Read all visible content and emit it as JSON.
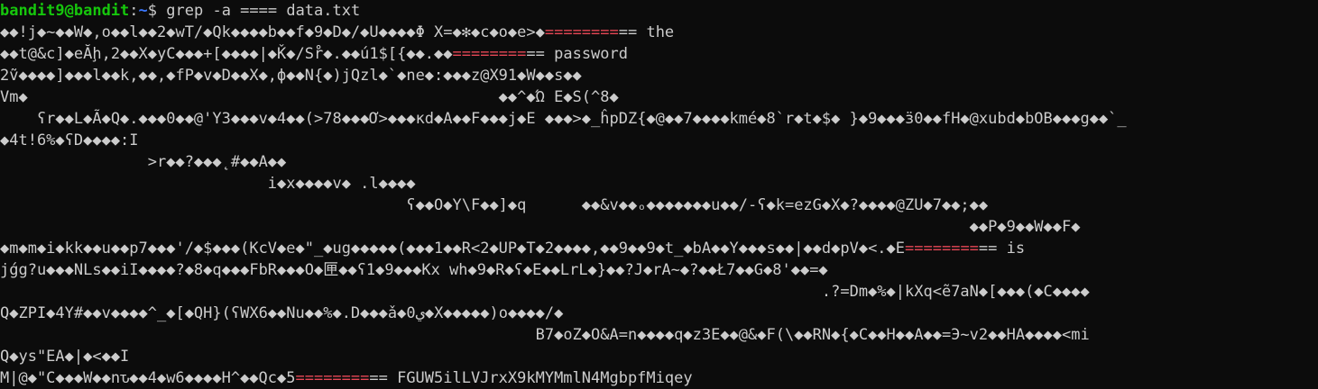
{
  "terminal": {
    "prompt": {
      "userhost": "bandit9@bandit",
      "sep": ":",
      "cwd": "~",
      "symbol": "$ ",
      "command": "grep -a ==== data.txt"
    },
    "lines": [
      {
        "pre": "◆◆!j◆~◆◆W◆,o◆◆l◆◆2◆wT/◆Qk◆◆◆◆b◆◆f◆9◆D◆/◆U◆◆◆◆Φ X=◆✻◆c◆o◆e>◆",
        "hl": "========",
        "post": "== the"
      },
      {
        "pre": "◆◆t@&c]◆eĂḩ,2◆◆X◆yC◆◆◆+[◆◆◆◆|◆Ǩ◆/Sr̊◆.◆◆ú1$[{◆◆.◆◆",
        "hl": "========",
        "post": "== password"
      },
      {
        "pre": "2ṽ◆◆◆◆]◆◆◆l◆◆k,◆◆,◆fP◆v◆D◆◆X◆,ф◆◆N{◆)jQzl◆`◆ne◆:◆◆◆z@X91◆W◆◆s◆◆",
        "hl": "",
        "post": ""
      },
      {
        "pre": "Vm◆                                                   ◆◆^◆Ώ E◆S(^8◆",
        "hl": "",
        "post": ""
      },
      {
        "pre": "    ʕr◆◆L◆Ã◆Q◆.◆◆◆0◆◆@'Y3◆◆◆v◆4◆◆(>78◆◆◆Ơ>◆◆◆κd◆A◆◆F◆◆◆j◆E ◆◆◆>◆_ĥpDZ{◆@◆◆7◆◆◆◆kmé◆8`r◆t◆$◆ }◆9◆◆◆ӟ0◆◆fH◆@xubd◆bOB◆◆◆g◆◆`_",
        "hl": "",
        "post": ""
      },
      {
        "pre": "◆4t!6%◆ʕD◆◆◆◆:I",
        "hl": "",
        "post": ""
      },
      {
        "pre": "                >r◆◆?◆◆◆˛#◆◆A◆◆",
        "hl": "",
        "post": ""
      },
      {
        "pre": "                             i◆x◆◆◆◆v◆ .l◆◆◆◆",
        "hl": "",
        "post": ""
      },
      {
        "pre": "                                            ʕ◆◆O◆Y\\F◆◆]◆q      ◆◆&v◆◆ₒ◆◆◆◆◆◆◆u◆◆/-ʕ◆k=ezG◆X◆?◆◆◆◆@ZU◆7◆◆;◆◆",
        "hl": "",
        "post": ""
      },
      {
        "pre": "                                                                                                         ◆◆P◆9◆◆W◆◆F◆",
        "hl": "",
        "post": ""
      },
      {
        "pre": "◆m◆m◆i◆kk◆◆u◆◆p7◆◆◆'/◆$◆◆◆(KcV◆e◆\"_◆ug◆◆◆◆◆(◆◆◆1◆◆R<2◆UP◆T◆2◆◆◆◆,◆◆9◆◆9◆t_◆bA◆◆Y◆◆◆s◆◆|◆◆d◆pV◆<.◆E",
        "hl": "========",
        "post": "== is"
      },
      {
        "pre": "jǵg?u◆◆◆NLs◆◆iI◆◆◆◆?◆8◆q◆◆◆FbR◆◆◆O◆匣◆◆ʕ1◆9◆◆◆Kx wh◆9◆R◆ʕ◆E◆◆LrL◆}◆◆?J◆rA~◆?◆◆Ł7◆◆G◆8'◆◆=◆",
        "hl": "",
        "post": ""
      },
      {
        "pre": "                                                                                         .?=Dm◆%◆|kXq<ẽ7aN◆[◆◆◆(◆C◆◆◆◆",
        "hl": "",
        "post": ""
      },
      {
        "pre": "Q◆ZPI◆4Y#◆◆v◆◆◆◆^_◆[◆QH}(ʕWX6◆◆Nu◆◆%◆.D◆◆◆ǎ◆0ي◆X◆◆◆◆◆)o◆◆◆◆/◆",
        "hl": "",
        "post": ""
      },
      {
        "pre": "                                                          B7◆oZ◆O&A=n◆◆◆◆q◆z3E◆◆@&◆F(\\◆◆RN◆{◆C◆◆H◆◆A◆◆=Э~v2◆◆HA◆◆◆◆<mi",
        "hl": "",
        "post": ""
      },
      {
        "pre": "Q◆ys\"EA◆|◆<◆◆I",
        "hl": "",
        "post": ""
      },
      {
        "pre": "M|@◆\"C◆◆◆W◆◆nԏ◆◆4◆w6◆◆◆◆H^◆◆Qc◆5",
        "hl": "========",
        "post": "== FGUW5ilLVJrxX9kMYMmlN4MgbpfMiqey"
      }
    ]
  }
}
